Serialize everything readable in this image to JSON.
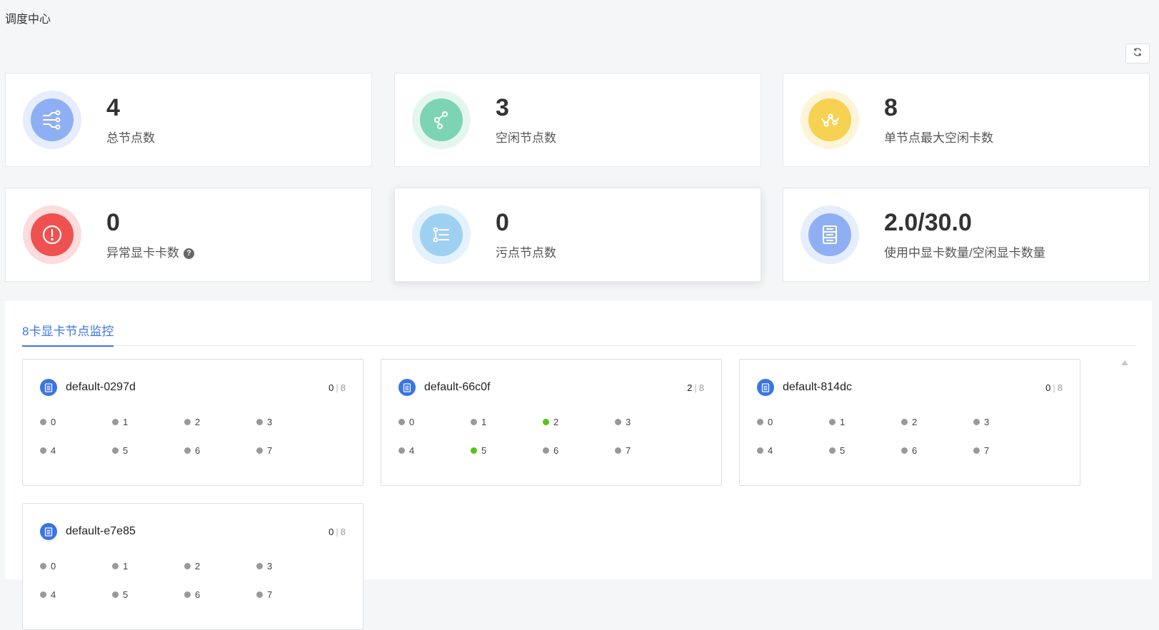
{
  "page": {
    "title": "调度中心"
  },
  "toolbar": {
    "refresh_icon": "refresh-icon"
  },
  "stats": [
    {
      "value": "4",
      "label": "总节点数",
      "icon": "node-tree-icon",
      "color": "#8faff5",
      "ring": "#e6eefd"
    },
    {
      "value": "3",
      "label": "空闲节点数",
      "icon": "share-nodes-icon",
      "color": "#7dd4b4",
      "ring": "#e5f6ef"
    },
    {
      "value": "8",
      "label": "单节点最大空闲卡数",
      "icon": "line-chart-icon",
      "color": "#f7d151",
      "ring": "#fdf4d9"
    },
    {
      "value": "0",
      "label": "异常显卡卡数",
      "icon": "alert-icon",
      "color": "#ef5150",
      "ring": "#fcdcdc",
      "help": "?"
    },
    {
      "value": "0",
      "label": "污点节点数",
      "icon": "list-icon",
      "color": "#9ed0f2",
      "ring": "#e3f2fc"
    },
    {
      "value": "2.0/30.0",
      "label": "使用中显卡数量/空闲显卡数量",
      "icon": "server-icon",
      "color": "#8faff5",
      "ring": "#e6eefd"
    }
  ],
  "monitor": {
    "tab_label": "8卡显卡节点监控",
    "nodes": [
      {
        "name": "default-0297d",
        "used": "0",
        "total": "8",
        "gpus": [
          {
            "id": "0",
            "busy": false
          },
          {
            "id": "1",
            "busy": false
          },
          {
            "id": "2",
            "busy": false
          },
          {
            "id": "3",
            "busy": false
          },
          {
            "id": "4",
            "busy": false
          },
          {
            "id": "5",
            "busy": false
          },
          {
            "id": "6",
            "busy": false
          },
          {
            "id": "7",
            "busy": false
          }
        ]
      },
      {
        "name": "default-66c0f",
        "used": "2",
        "total": "8",
        "gpus": [
          {
            "id": "0",
            "busy": false
          },
          {
            "id": "1",
            "busy": false
          },
          {
            "id": "2",
            "busy": true
          },
          {
            "id": "3",
            "busy": false
          },
          {
            "id": "4",
            "busy": false
          },
          {
            "id": "5",
            "busy": true
          },
          {
            "id": "6",
            "busy": false
          },
          {
            "id": "7",
            "busy": false
          }
        ]
      },
      {
        "name": "default-814dc",
        "used": "0",
        "total": "8",
        "gpus": [
          {
            "id": "0",
            "busy": false
          },
          {
            "id": "1",
            "busy": false
          },
          {
            "id": "2",
            "busy": false
          },
          {
            "id": "3",
            "busy": false
          },
          {
            "id": "4",
            "busy": false
          },
          {
            "id": "5",
            "busy": false
          },
          {
            "id": "6",
            "busy": false
          },
          {
            "id": "7",
            "busy": false
          }
        ]
      },
      {
        "name": "default-e7e85",
        "used": "0",
        "total": "8",
        "gpus": [
          {
            "id": "0",
            "busy": false
          },
          {
            "id": "1",
            "busy": false
          },
          {
            "id": "2",
            "busy": false
          },
          {
            "id": "3",
            "busy": false
          },
          {
            "id": "4",
            "busy": false
          },
          {
            "id": "5",
            "busy": false
          },
          {
            "id": "6",
            "busy": false
          },
          {
            "id": "7",
            "busy": false
          }
        ]
      }
    ]
  }
}
